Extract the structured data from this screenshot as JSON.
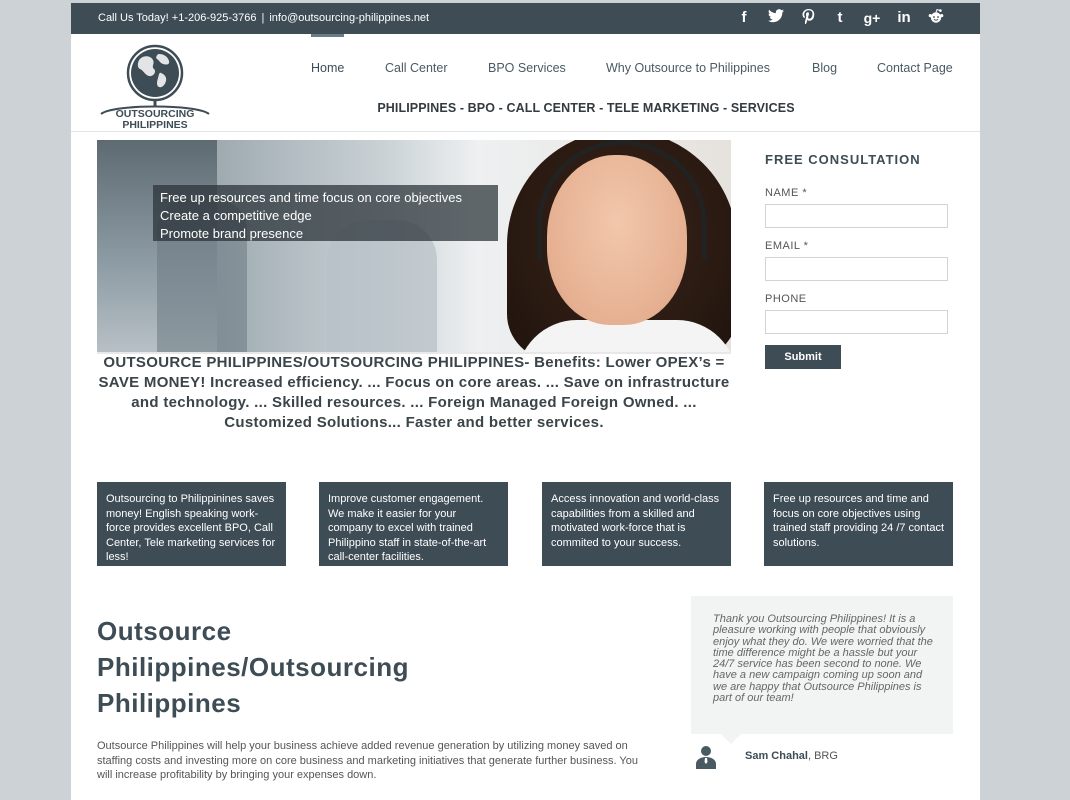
{
  "topbar": {
    "phone_text": "Call Us Today! +1-206-925-3766",
    "separator": "|",
    "email_text": "info@outsourcing-philippines.net",
    "social": [
      {
        "icon": "facebook-icon",
        "glyph": "f"
      },
      {
        "icon": "twitter-icon",
        "glyph": "🐦"
      },
      {
        "icon": "pinterest-icon",
        "glyph": "P"
      },
      {
        "icon": "tumblr-icon",
        "glyph": "t"
      },
      {
        "icon": "googleplus-icon",
        "glyph": "g+"
      },
      {
        "icon": "linkedin-icon",
        "glyph": "in"
      },
      {
        "icon": "reddit-icon",
        "glyph": "👽"
      }
    ]
  },
  "logo": {
    "line1": "OUTSOURCING",
    "line2": "PHILIPPINES"
  },
  "nav": {
    "items": [
      {
        "label": "Home",
        "active": true
      },
      {
        "label": "Call Center"
      },
      {
        "label": "BPO Services"
      },
      {
        "label": "Why Outsource to Philippines"
      },
      {
        "label": "Blog"
      },
      {
        "label": "Contact Page"
      }
    ],
    "tagline": "PHILIPPINES - BPO - CALL CENTER - TELE MARKETING - SERVICES"
  },
  "hero": {
    "lines": [
      "Free up resources and time focus on core objectives",
      "Create a competitive edge",
      "Promote brand presence"
    ]
  },
  "benefits": "OUTSOURCE PHILIPPINES/OUTSOURCING PHILIPPINES- Benefits: Lower OPEX’s = SAVE MONEY! Increased efficiency. ... Focus on core areas. ... Save on infrastructure and technology. ... Skilled resources. ... Foreign Managed Foreign Owned. ... Customized Solutions... Faster and better services.",
  "consultation": {
    "title": "FREE CONSULTATION",
    "name_label": "NAME *",
    "email_label": "EMAIL *",
    "phone_label": "PHONE",
    "submit_label": "Submit"
  },
  "boxes": [
    "Outsourcing to Philippinines saves money! English speaking work-force provides excellent BPO, Call Center, Tele marketing services for less!",
    "Improve customer engagement. We make it easier for your company to excel  with trained Philippino staff in state-of-the-art call-center facilities.",
    "Access innovation and world-class capabilities from a skilled and motivated work-force that is commited to your success.",
    "Free up resources and time and focus on core objectives using trained staff providing 24 /7 contact solutions."
  ],
  "main": {
    "title": "Outsource Philippines/Outsourcing Philippines",
    "paragraph": "Outsource Philippines will help your business achieve added revenue generation by utilizing money saved on staffing costs and investing more on core business and marketing initiatives that generate further business. You will increase profitability by bringing your expenses down."
  },
  "testimonial": {
    "quote": "Thank you Outsourcing Philippines! It is a pleasure working with people that obviously enjoy what they do. We were worried that the time difference might be a hassle but your 24/7 service has been second to none. We have a new campaign coming up soon and we are happy that Outsource Philippines is part of our team!",
    "author_name": "Sam Chahal",
    "author_company": "BRG"
  },
  "colors": {
    "primary": "#3e4c55",
    "page_bg": "#ccd2d6"
  }
}
